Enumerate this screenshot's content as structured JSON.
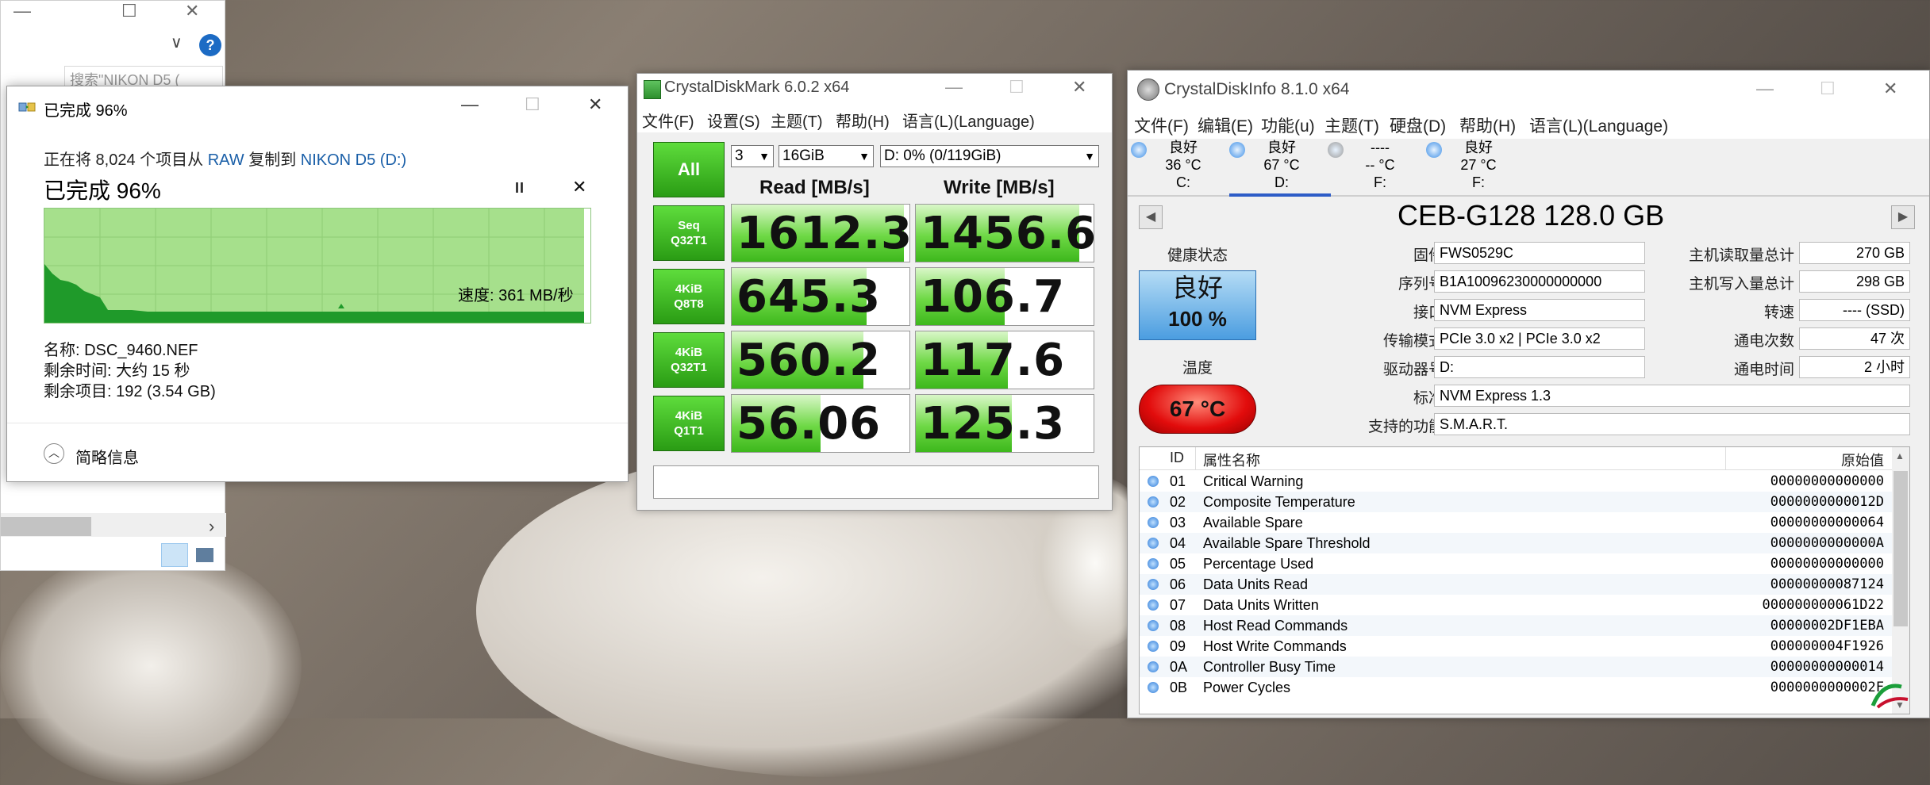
{
  "explorer": {
    "search_placeholder": "搜索\"NIKON D5 (",
    "chevron": "∨",
    "help": "?",
    "minimize": "—",
    "maximize": "☐",
    "close": "✕",
    "scroll_right": "›"
  },
  "copy": {
    "title": "已完成 96%",
    "line_prefix": "正在将 8,024 个项目从 ",
    "line_source": "RAW",
    "line_mid": " 复制到 ",
    "line_dest": "NIKON D5 (D:)",
    "percent_heading": "已完成 96%",
    "progress": 0.96,
    "pause": "II",
    "cancel": "✕",
    "speed": "速度: 361 MB/秒",
    "name": "名称:  DSC_9460.NEF",
    "time_left": "剩余时间:  大约 15 秒",
    "items_left": "剩余项目:  192 (3.54 GB)",
    "brief": "简略信息",
    "minimize": "—",
    "maximize": "☐",
    "close": "✕",
    "colors": {
      "graph_fill": "#a6e08c",
      "graph_curve": "#1f9a2a"
    }
  },
  "cdm": {
    "title": "CrystalDiskMark 6.0.2 x64",
    "menu": [
      "文件(F)",
      "设置(S)",
      "主题(T)",
      "帮助(H)",
      "语言(L)(Language)"
    ],
    "all_label": "All",
    "count": "3",
    "size": "16GiB",
    "drive": "D: 0% (0/119GiB)",
    "read_header": "Read [MB/s]",
    "write_header": "Write [MB/s]",
    "rows": [
      {
        "line1": "Seq",
        "line2": "Q32T1",
        "read": "1612.3",
        "write": "1456.6",
        "read_fill": 0.97,
        "write_fill": 0.92
      },
      {
        "line1": "4KiB",
        "line2": "Q8T8",
        "read": "645.3",
        "write": "106.7",
        "read_fill": 0.76,
        "write_fill": 0.5
      },
      {
        "line1": "4KiB",
        "line2": "Q32T1",
        "read": "560.2",
        "write": "117.6",
        "read_fill": 0.74,
        "write_fill": 0.52
      },
      {
        "line1": "4KiB",
        "line2": "Q1T1",
        "read": "56.06",
        "write": "125.3",
        "read_fill": 0.5,
        "write_fill": 0.54
      }
    ],
    "minimize": "—",
    "maximize": "☐",
    "close": "✕",
    "colors": {
      "button": "#36b01c",
      "fill": "#5fcf3a"
    }
  },
  "cdi": {
    "title": "CrystalDiskInfo 8.1.0 x64",
    "menu": [
      "文件(F)",
      "编辑(E)",
      "功能(u)",
      "主题(T)",
      "硬盘(D)",
      "帮助(H)",
      "语言(L)(Language)"
    ],
    "disks": [
      {
        "status": "良好",
        "temp": "36 °C",
        "letter": "C:",
        "color": "#3b8ee6"
      },
      {
        "status": "良好",
        "temp": "67 °C",
        "letter": "D:",
        "color": "#3b8ee6"
      },
      {
        "status": "----",
        "temp": "-- °C",
        "letter": "F:",
        "color": "#9a9a9a"
      },
      {
        "status": "良好",
        "temp": "27 °C",
        "letter": "F:",
        "color": "#3b8ee6"
      }
    ],
    "model": "CEB-G128 128.0 GB",
    "health_label": "健康状态",
    "health_status": "良好",
    "health_pct": "100 %",
    "temp_label": "温度",
    "temp_value": "67 °C",
    "firmware_label": "固件",
    "firmware": "FWS0529C",
    "serial_label": "序列号",
    "serial": "B1A10096230000000000",
    "interface_label": "接口",
    "interface": "NVM Express",
    "transfer_label": "传输模式",
    "transfer": "PCIe 3.0 x2 | PCIe 3.0 x2",
    "driveletter_label": "驱动器号",
    "driveletter": "D:",
    "standard_label": "标准",
    "standard": "NVM Express 1.3",
    "features_label": "支持的功能",
    "features": "S.M.A.R.T.",
    "host_read_label": "主机读取量总计",
    "host_read": "270 GB",
    "host_write_label": "主机写入量总计",
    "host_write": "298 GB",
    "rotation_label": "转速",
    "rotation": "---- (SSD)",
    "power_count_label": "通电次数",
    "power_count": "47 次",
    "power_hours_label": "通电时间",
    "power_hours": "2 小时",
    "table_headers": {
      "id": "ID",
      "name": "属性名称",
      "raw": "原始值"
    },
    "attributes": [
      {
        "id": "01",
        "name": "Critical Warning",
        "raw": "00000000000000"
      },
      {
        "id": "02",
        "name": "Composite Temperature",
        "raw": "0000000000012D"
      },
      {
        "id": "03",
        "name": "Available Spare",
        "raw": "00000000000064"
      },
      {
        "id": "04",
        "name": "Available Spare Threshold",
        "raw": "0000000000000A"
      },
      {
        "id": "05",
        "name": "Percentage Used",
        "raw": "00000000000000"
      },
      {
        "id": "06",
        "name": "Data Units Read",
        "raw": "00000000087124"
      },
      {
        "id": "07",
        "name": "Data Units Written",
        "raw": "000000000061D22"
      },
      {
        "id": "08",
        "name": "Host Read Commands",
        "raw": "00000002DF1EBA"
      },
      {
        "id": "09",
        "name": "Host Write Commands",
        "raw": "000000004F1926"
      },
      {
        "id": "0A",
        "name": "Controller Busy Time",
        "raw": "00000000000014"
      },
      {
        "id": "0B",
        "name": "Power Cycles",
        "raw": "0000000000002F"
      }
    ],
    "prev": "◀",
    "next": "▶",
    "scroll_up": "▲",
    "scroll_down": "▼",
    "minimize": "—",
    "maximize": "☐",
    "close": "✕",
    "colors": {
      "health": "#4b9de0",
      "temp": "#e20c0c"
    }
  }
}
